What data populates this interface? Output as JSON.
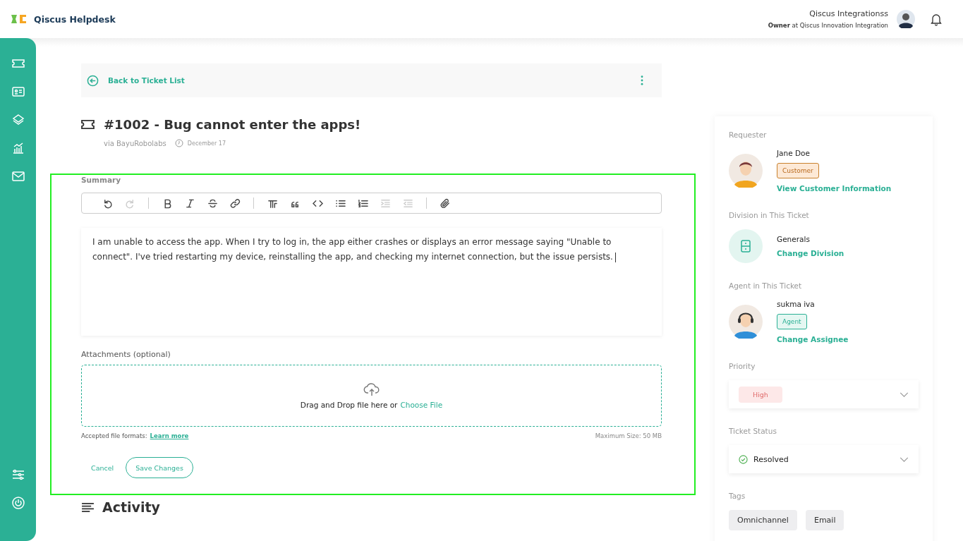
{
  "app": {
    "name": "Qiscus Helpdesk"
  },
  "user": {
    "name": "Qiscus Integrationss",
    "role_line": "**Owner** at Qiscus Innovation Integration"
  },
  "sidebar": {
    "top_items": [
      {
        "kind": "ticket"
      },
      {
        "kind": "contact"
      },
      {
        "kind": "layers"
      },
      {
        "kind": "chart"
      },
      {
        "kind": "mail"
      }
    ],
    "bottom_items": [
      {
        "kind": "sliders"
      },
      {
        "kind": "power"
      }
    ]
  },
  "back_bar": {
    "label": "Back to Ticket List"
  },
  "ticket": {
    "title": "#1002 - Bug cannot enter the apps!",
    "source": "via BayuRobolabs",
    "date": "December 17"
  },
  "editor": {
    "label": "Summary",
    "toolbar": [
      {
        "kind": "undo",
        "disabled": false
      },
      {
        "kind": "redo",
        "disabled": true
      },
      {
        "kind": "separator"
      },
      {
        "kind": "bold",
        "disabled": false
      },
      {
        "kind": "italic",
        "disabled": false
      },
      {
        "kind": "strike",
        "disabled": false
      },
      {
        "kind": "link",
        "disabled": false
      },
      {
        "kind": "separator"
      },
      {
        "kind": "heading",
        "disabled": false
      },
      {
        "kind": "quote",
        "disabled": false
      },
      {
        "kind": "code",
        "disabled": false
      },
      {
        "kind": "bullets",
        "disabled": false
      },
      {
        "kind": "numbers",
        "disabled": false
      },
      {
        "kind": "indent",
        "disabled": true
      },
      {
        "kind": "outdent",
        "disabled": true
      },
      {
        "kind": "separator"
      },
      {
        "kind": "attach",
        "disabled": false
      }
    ],
    "body": " I am unable to access the app. When I try to log in, the app either crashes or displays an error message saying \"Unable to connect\". I've tried restarting my device, reinstalling the app, and checking my internet connection, but the issue persists."
  },
  "attachments": {
    "label": "Attachments (optional)",
    "drop_text": "Drag and Drop file here or",
    "choose_link": "Choose File",
    "formats_label": "Accepted file formats:",
    "learn_more": "Learn more",
    "max_size": "Maximum Size: 50 MB"
  },
  "actions": {
    "cancel": "Cancel",
    "save": "Save Changes"
  },
  "activity": {
    "title": "Activity"
  },
  "side_panel": {
    "requester": {
      "label": "Requester",
      "name": "Jane Doe",
      "badge": "Customer",
      "link": "View Customer Information"
    },
    "division": {
      "label": "Division in This Ticket",
      "name": "Generals",
      "link": "Change Division"
    },
    "agent": {
      "label": "Agent in This Ticket",
      "name": "sukma iva",
      "badge": "Agent",
      "link": "Change Assignee"
    },
    "priority": {
      "label": "Priority",
      "value": "High"
    },
    "status": {
      "label": "Ticket Status",
      "value": "Resolved"
    },
    "tags": {
      "label": "Tags",
      "items": [
        "Omnichannel",
        "Email"
      ]
    }
  }
}
